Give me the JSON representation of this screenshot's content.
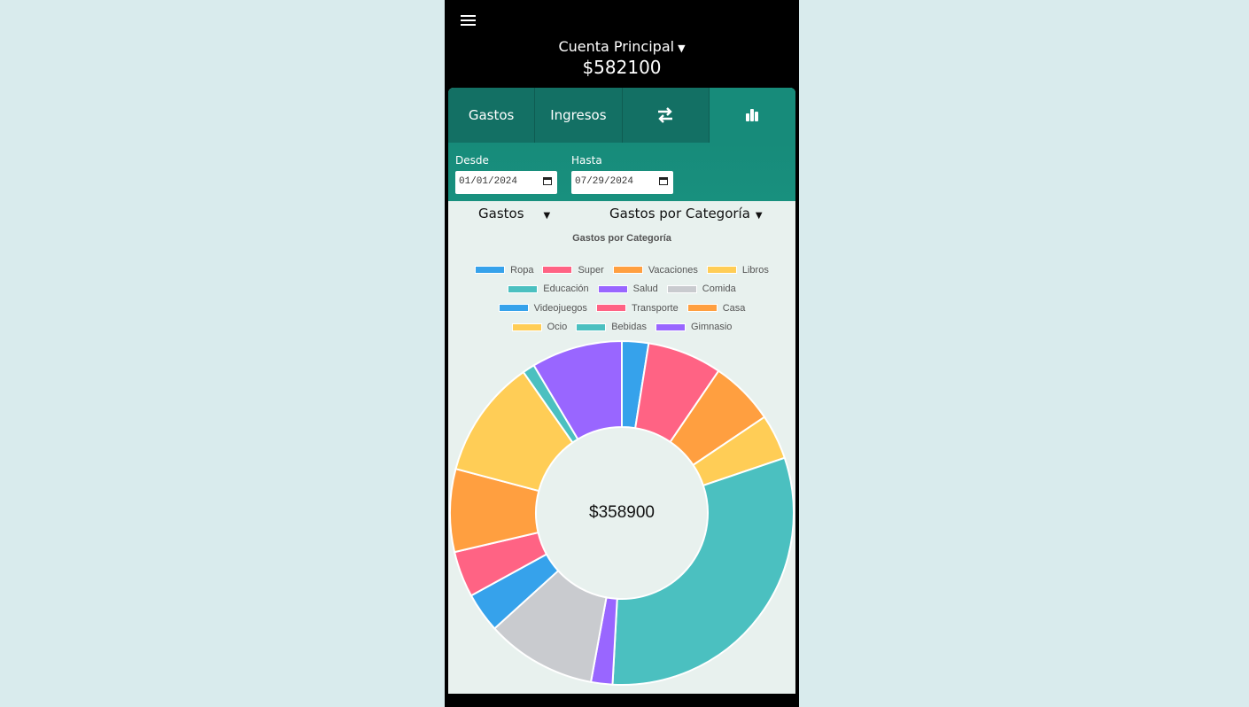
{
  "header": {
    "account_name": "Cuenta Principal",
    "balance": "$582100"
  },
  "tabs": [
    {
      "label": "Gastos"
    },
    {
      "label": "Ingresos"
    },
    {
      "label": "",
      "icon": "transfer-icon"
    },
    {
      "label": "",
      "icon": "bar-chart-icon",
      "active": true
    }
  ],
  "filters": {
    "from_label": "Desde",
    "from_value": "01/01/2024",
    "to_label": "Hasta",
    "to_value": "07/29/2024"
  },
  "selects": {
    "type_value": "Gastos",
    "view_value": "Gastos por Categoría"
  },
  "colors": {
    "header_bg": "#000000",
    "tab_active": "#178b7a",
    "tab_inactive": "#137064",
    "panel_bg": "#e8f1ee"
  },
  "chart_data": {
    "type": "pie",
    "title": "Gastos por Categoría",
    "center_label": "$358900",
    "legend_position": "top",
    "categories": [
      "Ropa",
      "Super",
      "Vacaciones",
      "Libros",
      "Educación",
      "Salud",
      "Comida",
      "Videojuegos",
      "Transporte",
      "Casa",
      "Ocio",
      "Bebidas",
      "Gimnasio"
    ],
    "colors": [
      "#36a2eb",
      "#ff6384",
      "#ff9f40",
      "#ffcd56",
      "#4bc0c0",
      "#9966ff",
      "#c9cbcf",
      "#36a2eb",
      "#ff6384",
      "#ff9f40",
      "#ffcd56",
      "#4bc0c0",
      "#9966ff"
    ],
    "values": [
      2.6,
      7.3,
      6.3,
      4.4,
      32.3,
      2.1,
      10.8,
      3.9,
      4.5,
      8.1,
      11.6,
      1.2,
      8.9
    ]
  }
}
